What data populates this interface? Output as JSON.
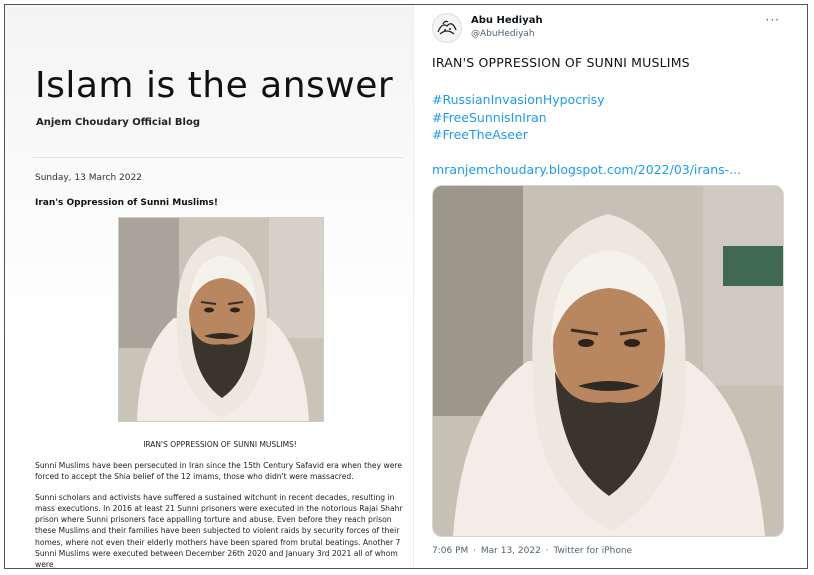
{
  "blog": {
    "title": "Islam is the answer",
    "subtitle": "Anjem Choudary Official Blog",
    "post_date": "Sunday, 13 March 2022",
    "post_title": "Iran's Oppression of Sunni Muslims!",
    "image_caption": "IRAN'S OPPRESSION OF SUNNI MUSLIMS!",
    "paragraphs": [
      "Sunni Muslims have been persecuted in Iran since the 15th Century Safavid era when they were forced to accept the Shia belief of the  12 imams, those who didn't were massacred.",
      "Sunni scholars and activists have suffered a sustained witchunt in recent decades, resulting in mass executions.  In 2016 at least 21 Sunni prisoners were executed in the notorious Rajai Shahr prison where  Sunni prisoners face appalling torture and abuse. Even before they reach prison these Muslims and their families have been subjected to violent raids by security forces of their homes, where not even their elderly mothers have been spared from brutal beatings. Another 7 Sunni Muslims were  executed between December 26th 2020 and January 3rd 2021 all of whom were"
    ]
  },
  "tweet": {
    "author_name": "Abu Hediyah",
    "author_handle": "@AbuHediyah",
    "more_icon": "more-horizontal-icon",
    "more_glyph": "···",
    "text": "IRAN'S OPPRESSION OF SUNNI MUSLIMS",
    "hashtags": [
      "#RussianInvasionHypocrisy",
      "#FreeSunnisInIran",
      "#FreeTheAseer"
    ],
    "link": "mranjemchoudary.blogspot.com/2022/03/irans-...",
    "time": "7:06 PM",
    "separator": "·",
    "date": "Mar 13, 2022",
    "source": "Twitter for iPhone"
  },
  "colors": {
    "link_blue": "#1d9bf0",
    "secondary_text": "#536471",
    "turban_white": "#f2eee7",
    "beard_dark": "#3a342c",
    "skin": "#b9875f"
  }
}
